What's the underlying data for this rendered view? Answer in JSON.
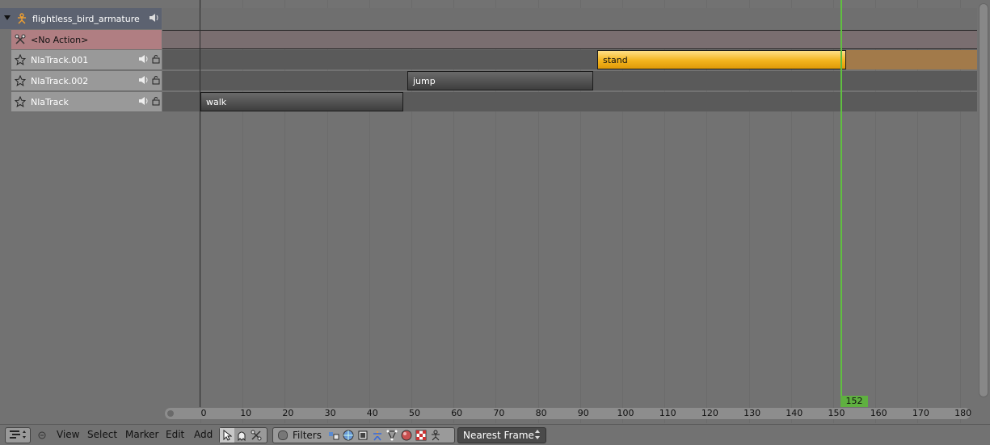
{
  "sidebar": {
    "object": {
      "label": "flightless_bird_armature",
      "icon": "armature-icon"
    },
    "no_action": {
      "label": "<No Action>"
    },
    "tracks": [
      {
        "label": "NlaTrack.001"
      },
      {
        "label": "NlaTrack.002"
      },
      {
        "label": "NlaTrack"
      }
    ]
  },
  "strips": [
    {
      "label": "stand",
      "start": 94,
      "end": 153,
      "track": 0,
      "active": true
    },
    {
      "label": "jump",
      "start": 49,
      "end": 93,
      "track": 1,
      "active": false
    },
    {
      "label": "walk",
      "start": 0,
      "end": 48,
      "track": 2,
      "active": false
    }
  ],
  "timeline": {
    "ticks": [
      "0",
      "10",
      "20",
      "30",
      "40",
      "50",
      "60",
      "70",
      "80",
      "90",
      "100",
      "110",
      "120",
      "130",
      "140",
      "150",
      "160",
      "170",
      "180"
    ],
    "current_frame": "152"
  },
  "toolbar": {
    "menus": [
      "View",
      "Select",
      "Marker",
      "Edit",
      "Add"
    ],
    "filters_label": "Filters",
    "snap_mode": "Nearest Frame"
  },
  "colors": {
    "active_strip": "#f4b41d",
    "playhead": "#60c040",
    "no_action_row": "#b07e82"
  }
}
